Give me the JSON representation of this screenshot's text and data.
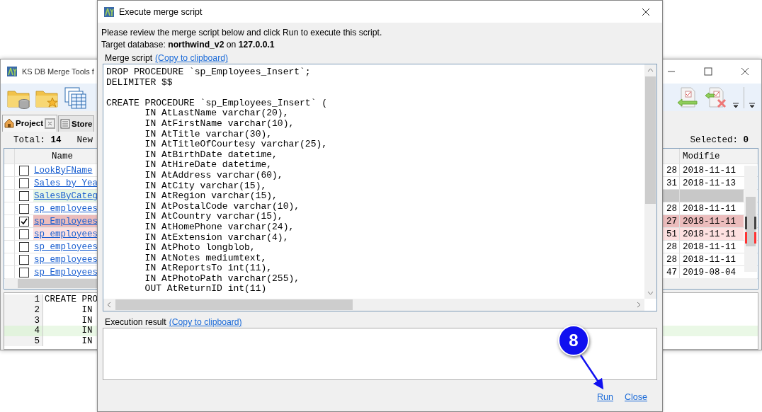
{
  "background_window": {
    "title": "KS DB Merge Tools f",
    "tabs": [
      {
        "label": "Project",
        "selected": true
      },
      {
        "label": "Store",
        "selected": false
      }
    ],
    "summary": {
      "total": "Total: **14**",
      "new": "New",
      "selected": "Selected: **0**"
    },
    "grid": {
      "columns": [
        "Name",
        "Modifie"
      ],
      "rows": [
        {
          "checked": false,
          "kind": "normal",
          "name": "LookByFName",
          "column_3": "28",
          "modified": "2018-11-11"
        },
        {
          "checked": false,
          "kind": "normal",
          "name": "Sales by Yea",
          "column_3": "31",
          "modified": "2018-11-13"
        },
        {
          "checked": false,
          "kind": "added",
          "name": "SalesByCateg"
        },
        {
          "checked": false,
          "kind": "normal",
          "name": "sp_employees",
          "column_3": "28",
          "modified": "2018-11-11"
        },
        {
          "checked": true,
          "kind": "changed",
          "name": "sp_Employees",
          "column_3": "27",
          "modified": "2018-11-11"
        },
        {
          "checked": false,
          "kind": "changed",
          "name": "sp_employees",
          "column_3": "51",
          "modified": "2018-11-11"
        },
        {
          "checked": false,
          "kind": "normal",
          "name": "sp_employees",
          "column_3": "28",
          "modified": "2018-11-11"
        },
        {
          "checked": false,
          "kind": "normal",
          "name": "sp_employees",
          "column_3": "28",
          "modified": "2018-11-11"
        },
        {
          "checked": false,
          "kind": "normal",
          "name": "sp_Employees",
          "column_3": "47",
          "modified": "2019-08-04"
        }
      ]
    },
    "code_pane": {
      "lines": [
        {
          "number": "1",
          "text": "CREATE PRO",
          "kind": "normal"
        },
        {
          "number": "2",
          "text": "\tIN",
          "kind": "normal"
        },
        {
          "number": "3",
          "text": "\tIN",
          "kind": "normal"
        },
        {
          "number": "4",
          "text": "\tIN",
          "kind": "added"
        },
        {
          "number": "5",
          "text": "\tIN",
          "kind": "normal"
        }
      ]
    }
  },
  "dialog": {
    "title": "Execute merge script",
    "intro": "Please review the merge script below and click Run to execute this script.",
    "target": "Target database: **northwind_v2** on **127.0.0.1**",
    "script_label": "Merge script",
    "script_link": "(Copy to clipboard)",
    "script_sections": [
      [
        "DROP PROCEDURE `sp_Employees_Insert`;",
        "DELIMITER $$"
      ],
      [
        "CREATE PROCEDURE `sp_Employees_Insert` (",
        "\tIN AtLastName varchar(20),",
        "\tIN AtFirstName varchar(10),",
        "\tIN AtTitle varchar(30),",
        "\tIN AtTitleOfCourtesy varchar(25),",
        "\tIN AtBirthDate datetime,",
        "\tIN AtHireDate datetime,",
        "\tIN AtAddress varchar(60),",
        "\tIN AtCity varchar(15),",
        "\tIN AtRegion varchar(15),",
        "\tIN AtPostalCode varchar(10),",
        "\tIN AtCountry varchar(15),",
        "\tIN AtHomePhone varchar(24),",
        "\tIN AtExtension varchar(4),",
        "\tIN AtPhoto longblob,",
        "\tIN AtNotes mediumtext,",
        "\tIN AtReportsTo int(11),",
        "\tIN AtPhotoPath varchar(255),",
        "\tOUT AtReturnID int(11)"
      ]
    ],
    "result_label": "Execution result",
    "result_link": "(Copy to clipboard)",
    "buttons": [
      "Run",
      "Close"
    ]
  },
  "annotation": {
    "label": "8"
  }
}
